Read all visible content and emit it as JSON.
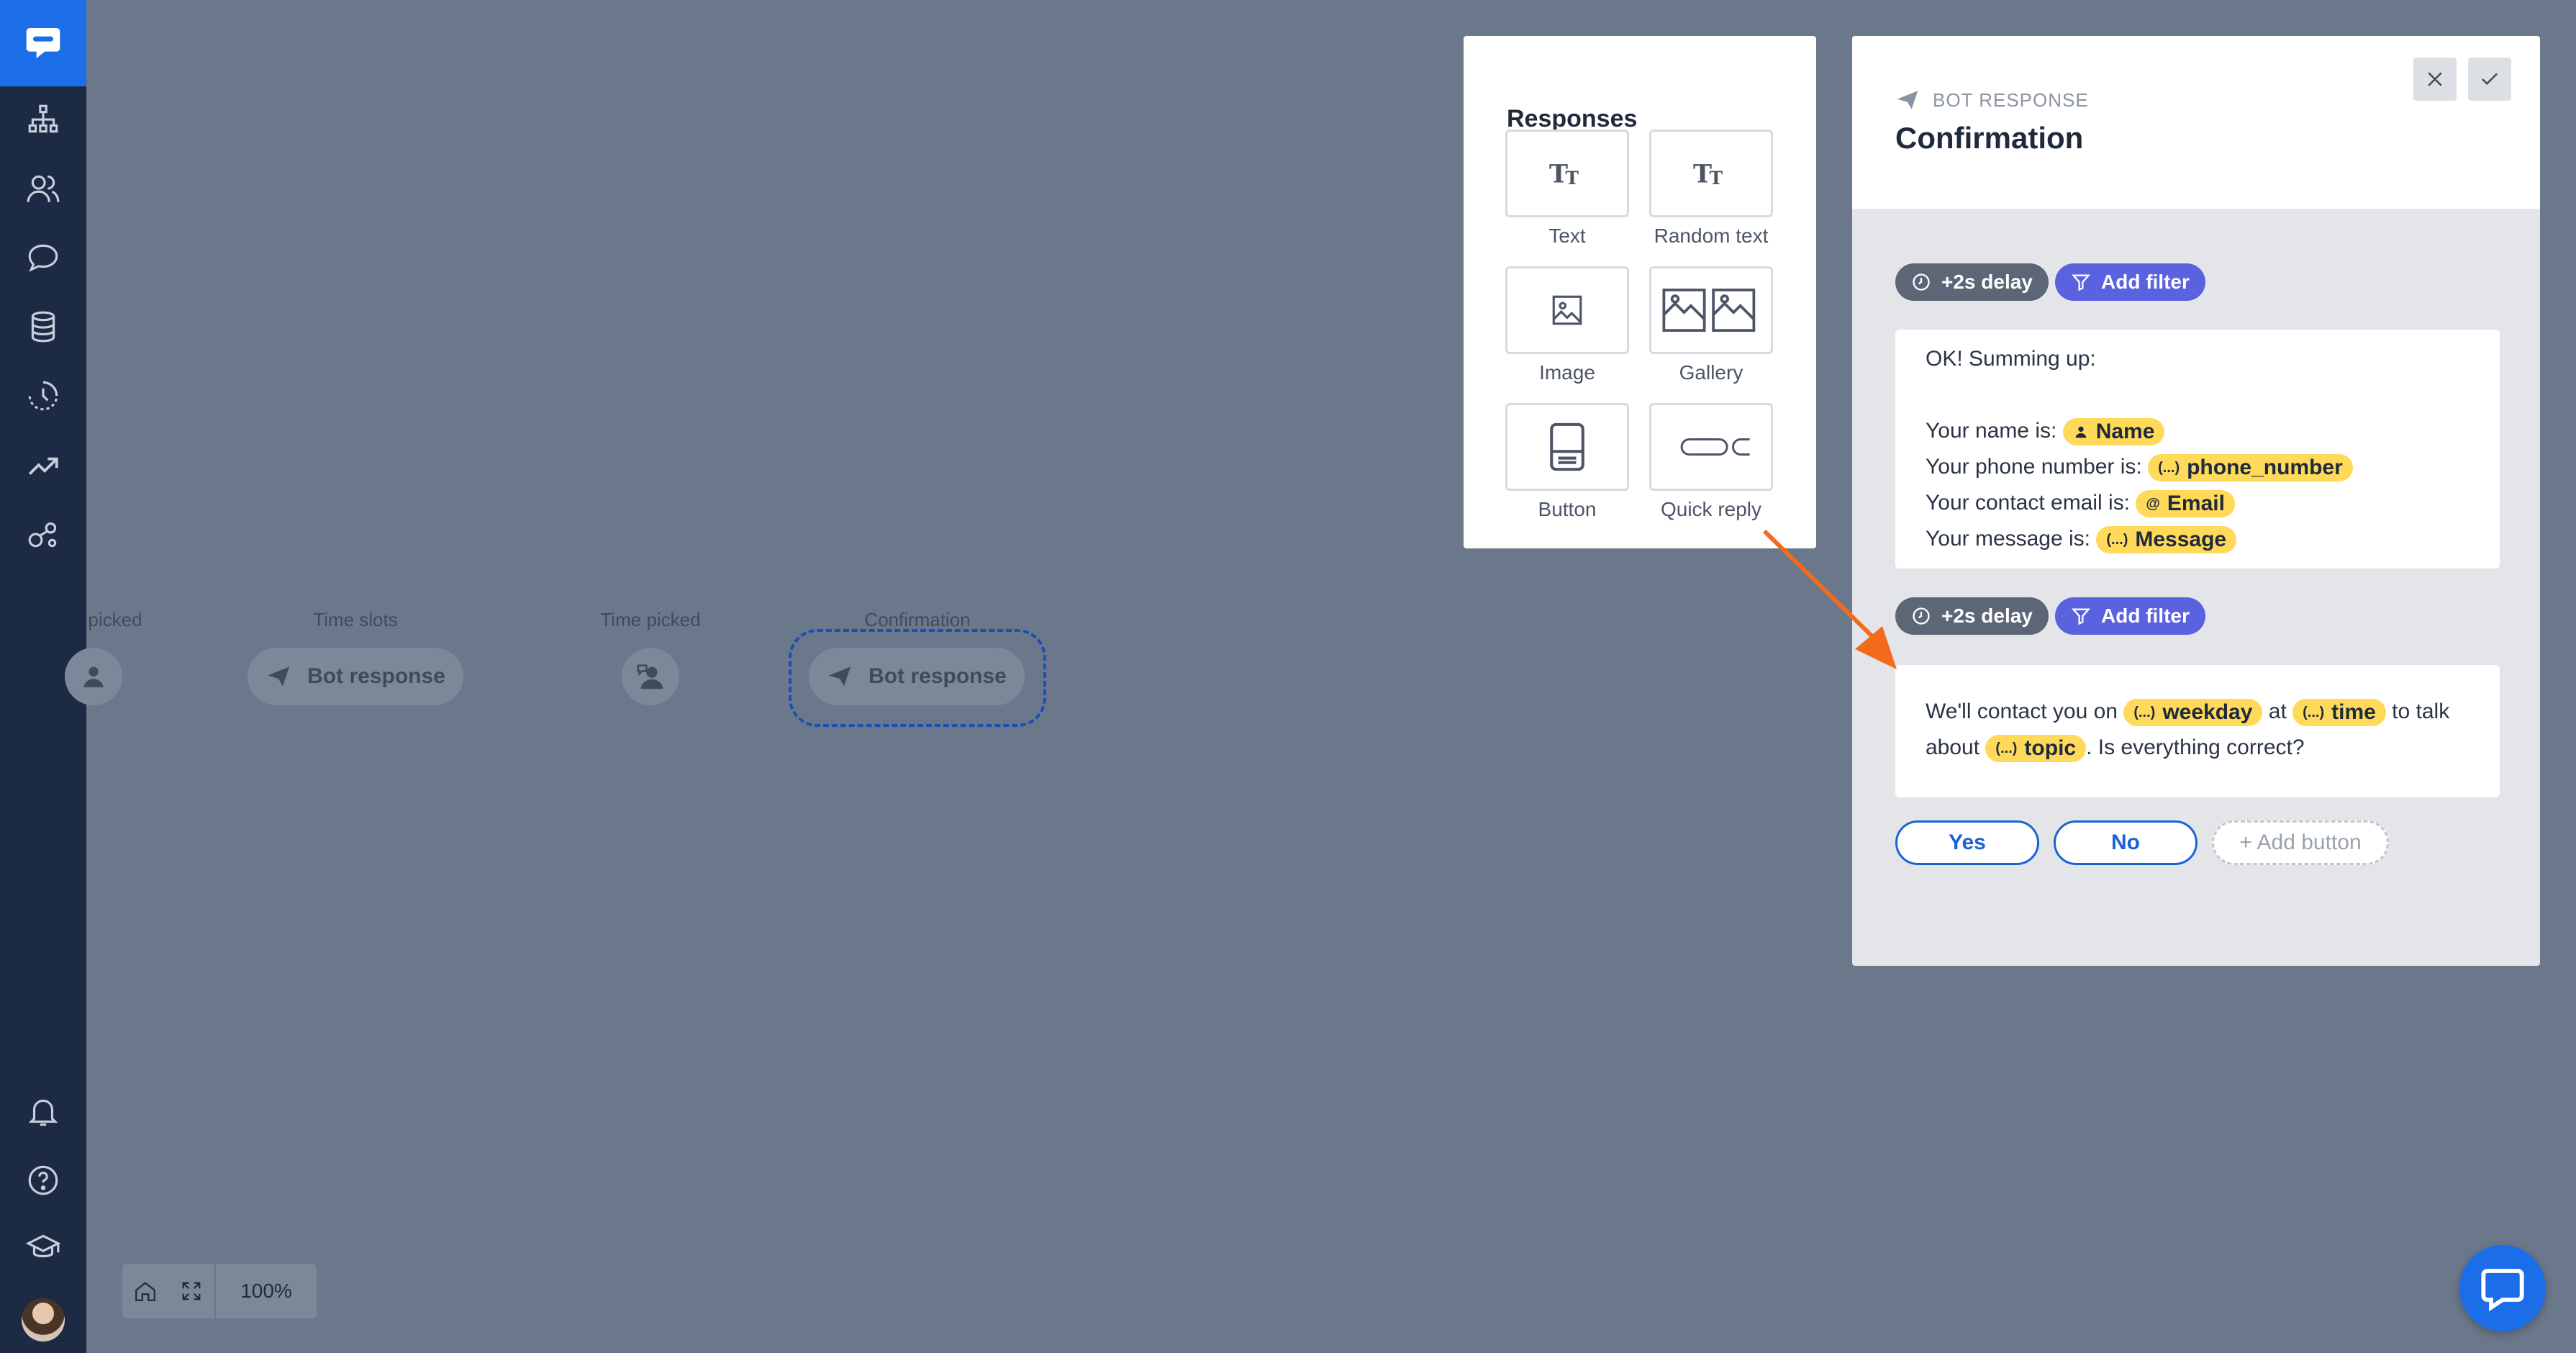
{
  "sidebar": {
    "items": [
      {
        "icon": "chatbot-logo-icon"
      },
      {
        "icon": "stories-tree-icon"
      },
      {
        "icon": "users-icon"
      },
      {
        "icon": "chats-icon"
      },
      {
        "icon": "database-icon"
      },
      {
        "icon": "history-icon"
      },
      {
        "icon": "reports-icon"
      },
      {
        "icon": "integrations-icon"
      },
      {
        "icon": "notifications-bell-icon"
      },
      {
        "icon": "help-icon"
      },
      {
        "icon": "academy-icon"
      },
      {
        "icon": "user-avatar"
      }
    ]
  },
  "canvas": {
    "nodes": [
      {
        "label": "picked",
        "type": "user-input"
      },
      {
        "label": "Time slots",
        "type": "bot-response",
        "pill": "Bot response"
      },
      {
        "label": "Time picked",
        "type": "user-input"
      },
      {
        "label": "Confirmation",
        "type": "bot-response",
        "pill": "Bot response",
        "selected": true
      }
    ],
    "zoom": "100%"
  },
  "responses_panel": {
    "title": "Responses",
    "items": [
      {
        "label": "Text",
        "icon": "text-icon"
      },
      {
        "label": "Random text",
        "icon": "random-text-icon"
      },
      {
        "label": "Image",
        "icon": "image-icon"
      },
      {
        "label": "Gallery",
        "icon": "gallery-icon"
      },
      {
        "label": "Button",
        "icon": "button-icon"
      },
      {
        "label": "Quick reply",
        "icon": "quick-reply-icon"
      }
    ]
  },
  "editor": {
    "kind": "BOT RESPONSE",
    "title": "Confirmation",
    "blocks": [
      {
        "delay": "+2s delay",
        "filter": "Add filter",
        "intro": "OK! Summing up:",
        "lines": [
          {
            "text": "Your name is:",
            "var": "Name",
            "var_icon": "person"
          },
          {
            "text": "Your phone number is:",
            "var": "phone_number",
            "var_icon": "(...)"
          },
          {
            "text": "Your contact email is:",
            "var": "Email",
            "var_icon": "@"
          },
          {
            "text": "Your message is:",
            "var": "Message",
            "var_icon": "(...)"
          }
        ]
      },
      {
        "delay": "+2s delay",
        "filter": "Add filter",
        "parts": [
          "We'll contact you on",
          "weekday",
          "at",
          "time",
          "to talk about",
          "topic",
          ". Is everything correct?"
        ]
      }
    ],
    "buttons": [
      "Yes",
      "No",
      "+ Add button"
    ]
  },
  "colors": {
    "canvas_bg": "#6b788b",
    "sidebar_bg": "#1c2a44",
    "brand_blue": "#1b6ee8",
    "variable_yellow": "#ffd95a",
    "filter_purple": "#5b62e0",
    "arrow_orange": "#f26b1d"
  }
}
